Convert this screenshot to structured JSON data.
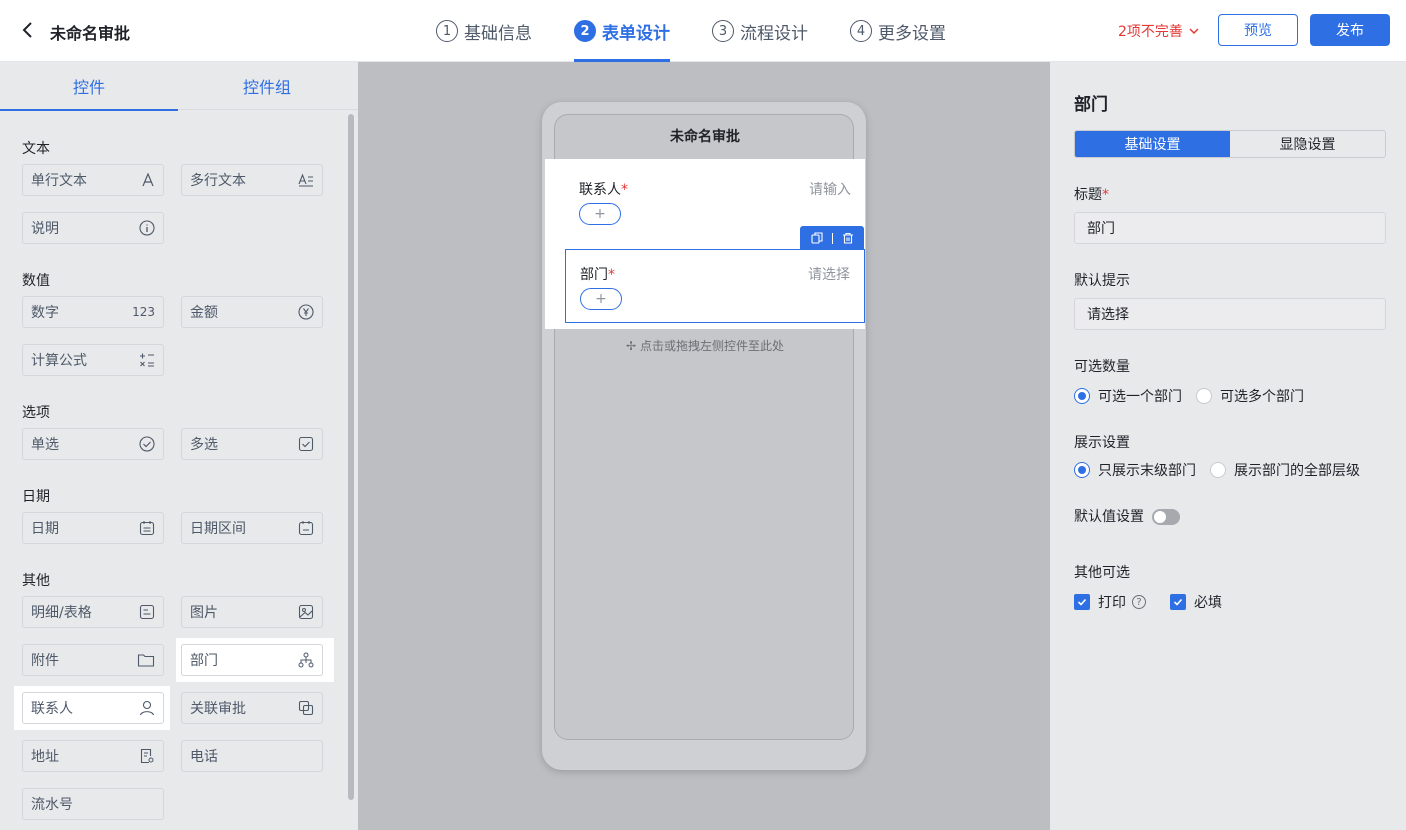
{
  "header": {
    "title": "未命名审批",
    "steps": [
      {
        "num": "1",
        "label": "基础信息"
      },
      {
        "num": "2",
        "label": "表单设计"
      },
      {
        "num": "3",
        "label": "流程设计"
      },
      {
        "num": "4",
        "label": "更多设置"
      }
    ],
    "incomplete": "2项不完善",
    "preview": "预览",
    "publish": "发布"
  },
  "left": {
    "tabs": [
      "控件",
      "控件组"
    ],
    "sections": {
      "text": "文本",
      "number": "数值",
      "options": "选项",
      "date": "日期",
      "other": "其他"
    },
    "controls": {
      "single_text": "单行文本",
      "multi_text": "多行文本",
      "description": "说明",
      "number": "数字",
      "amount": "金额",
      "formula": "计算公式",
      "radio": "单选",
      "checkbox": "多选",
      "date": "日期",
      "date_range": "日期区间",
      "detail_table": "明细/表格",
      "image": "图片",
      "attachment": "附件",
      "department": "部门",
      "contact": "联系人",
      "related_approval": "关联审批",
      "address": "地址",
      "phone": "电话",
      "serial_no": "流水号",
      "number_icon": "123"
    }
  },
  "canvas": {
    "form_title": "未命名审批",
    "fields": [
      {
        "label": "联系人",
        "placeholder": "请输入"
      },
      {
        "label": "部门",
        "placeholder": "请选择"
      }
    ],
    "required_mark": "*",
    "drop_hint": "点击或拖拽左侧控件至此处"
  },
  "props": {
    "title": "部门",
    "tabs": [
      "基础设置",
      "显隐设置"
    ],
    "label_title": "标题",
    "required_mark": "*",
    "title_value": "部门",
    "label_hint": "默认提示",
    "hint_value": "请选择",
    "label_count": "可选数量",
    "count_options": [
      "可选一个部门",
      "可选多个部门"
    ],
    "label_display": "展示设置",
    "display_options": [
      "只展示末级部门",
      "展示部门的全部层级"
    ],
    "label_default": "默认值设置",
    "label_other": "其他可选",
    "other_options": [
      "打印",
      "必填"
    ]
  },
  "colors": {
    "accent": "#2f6fe4",
    "warning": "#e53935"
  }
}
